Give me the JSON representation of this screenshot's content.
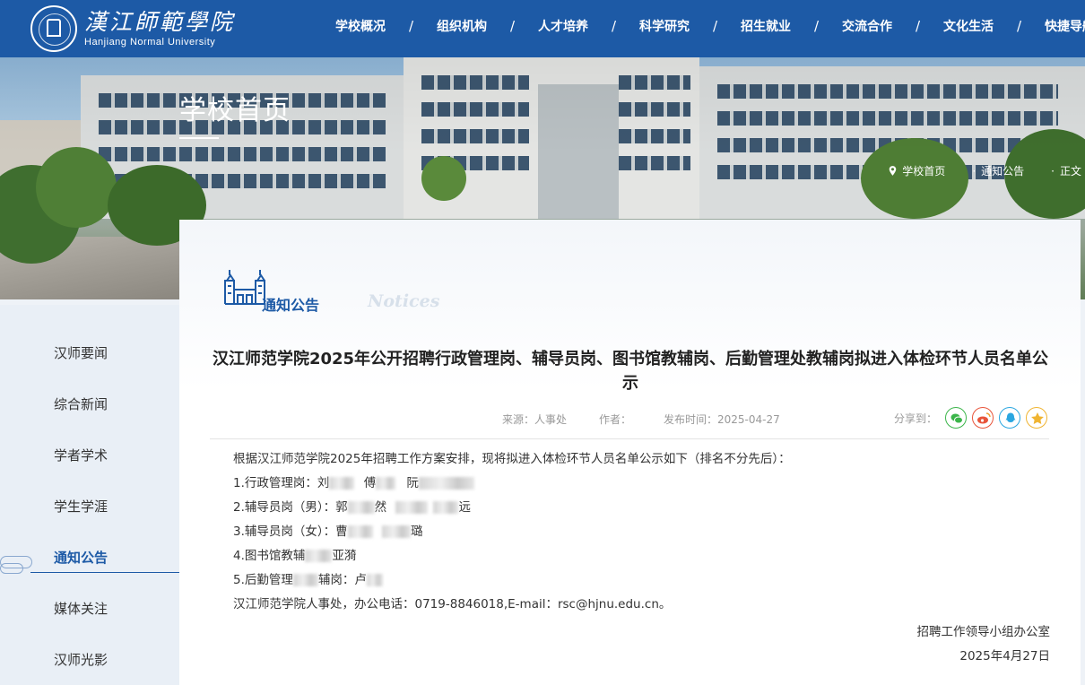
{
  "header": {
    "logo_cn": "漢江師範學院",
    "logo_en": "Hanjiang Normal University",
    "nav_items": [
      "学校概况",
      "组织机构",
      "人才培养",
      "科学研究",
      "招生就业",
      "交流合作",
      "文化生活",
      "快捷导航"
    ],
    "separator": "/"
  },
  "banner": {
    "page_title": "学校首页",
    "breadcrumb": [
      "学校首页",
      "通知公告",
      "正文"
    ],
    "breadcrumb_sep": "·"
  },
  "sidebar": {
    "items": [
      "汉师要闻",
      "综合新闻",
      "学者学术",
      "学生学涯",
      "通知公告",
      "媒体关注",
      "汉师光影"
    ],
    "active_index": 4
  },
  "section": {
    "title": "通知公告",
    "title_en": "Notices"
  },
  "article": {
    "title": "汉江师范学院2025年公开招聘行政管理岗、辅导员岗、图书馆教辅岗、后勤管理处教辅岗拟进入体检环节人员名单公示",
    "source": "来源：人事处",
    "author": "作者：",
    "date": "发布时间：2025-04-27",
    "share_label": "分享到：",
    "share_icons": [
      "wechat-icon",
      "weibo-icon",
      "qq-icon",
      "favorite-icon"
    ],
    "paragraphs": [
      "根据汉江师范学院2025年招聘工作方案安排，现将拟进入体检环节人员名单公示如下（排名不分先后）：",
      "1.行政管理岗：刘",
      "2.辅导员岗（男）：郭",
      "3.辅导员岗（女）：曹",
      "4.图书馆教辅",
      "5.后勤管理",
      "汉江师范学院人事处，办公电话：0719-8846018,E-mail：rsc@hjnu.edu.cn。"
    ],
    "fragments": {
      "p1_a": "傅",
      "p1_b": "阮",
      "p2_a": "然",
      "p2_b": "远",
      "p3_a": "璐",
      "p4_a": "亚漪",
      "p5_a": "辅岗：卢"
    },
    "signature_org": "招聘工作领导小组办公室",
    "signature_date": "2025年4月27日"
  },
  "colors": {
    "brand_blue": "#1d5aa6",
    "sidebar_bg": "#e9eff6",
    "wechat": "#3bb54a",
    "weibo": "#e8543a",
    "qq": "#2aa6e0",
    "favorite": "#f0b431"
  }
}
